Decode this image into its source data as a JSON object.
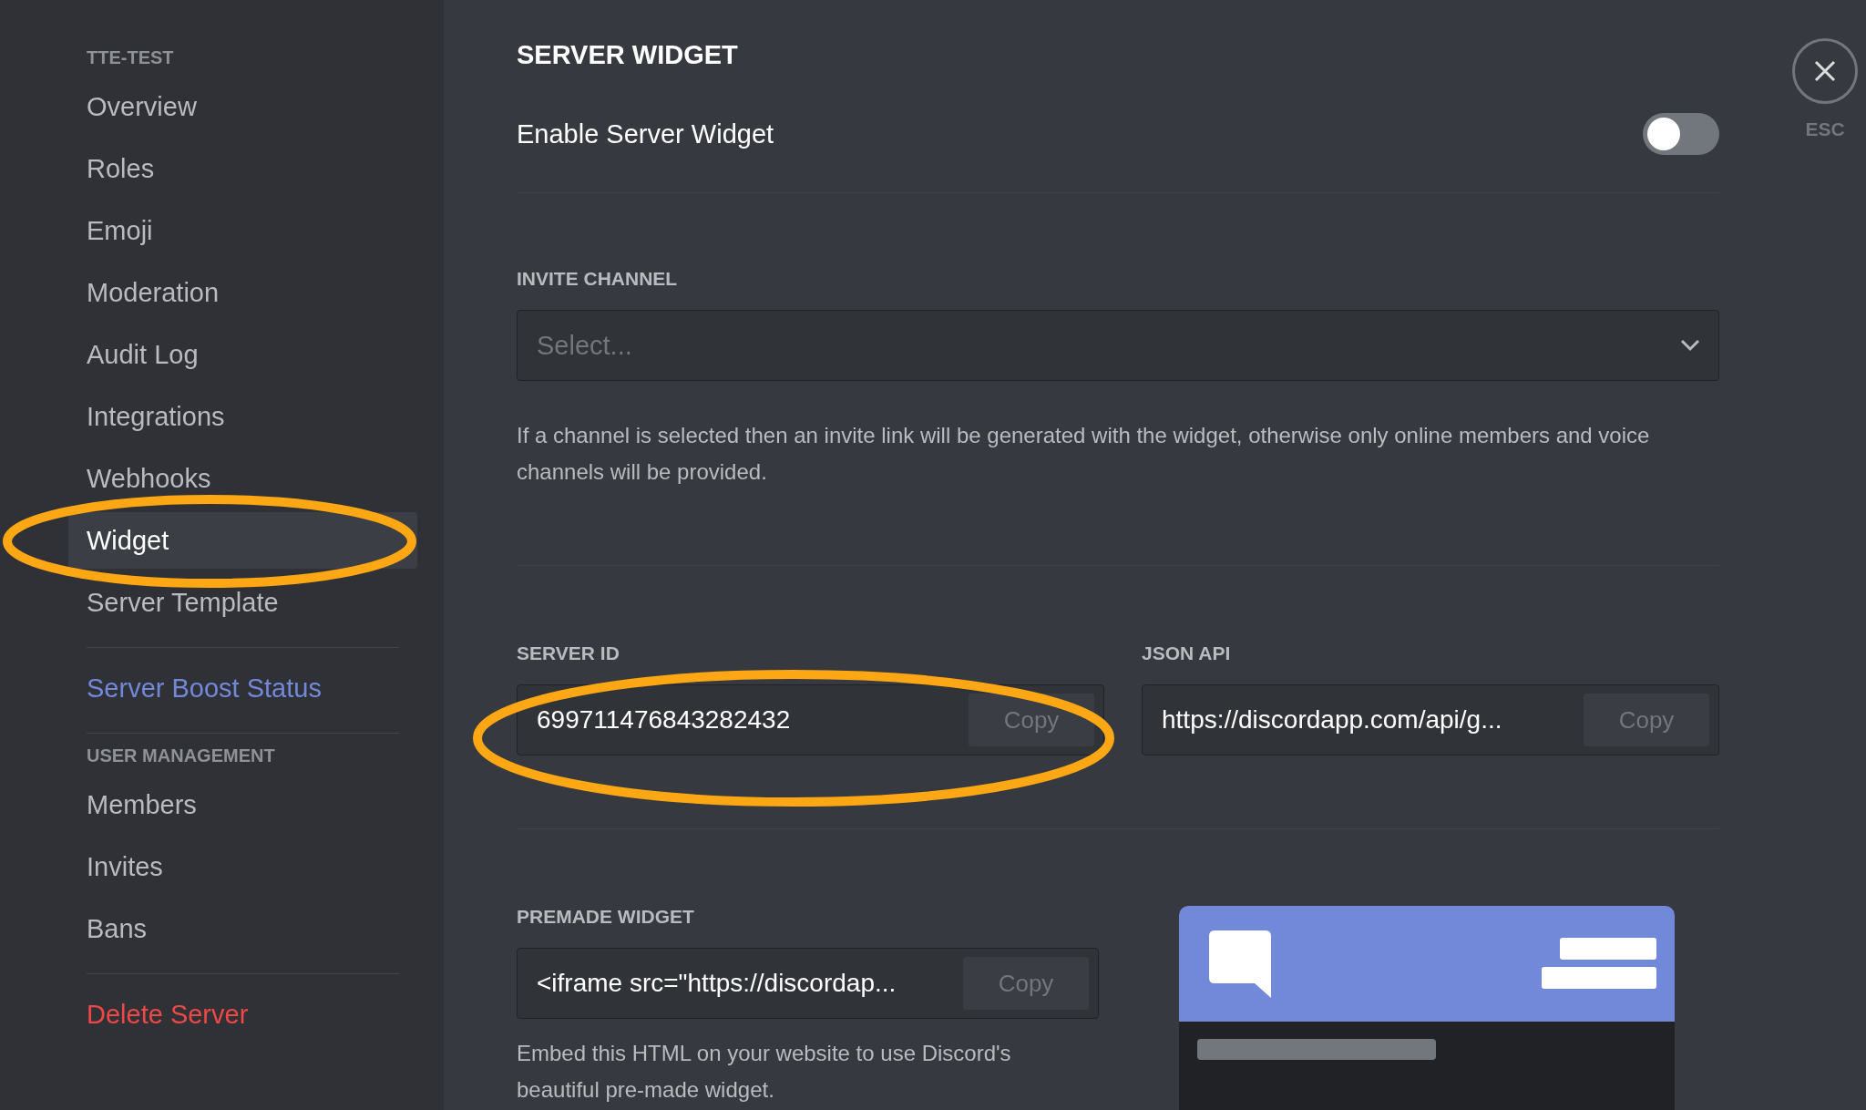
{
  "sidebar": {
    "groups": [
      {
        "header": "TTE-TEST",
        "items": [
          {
            "label": "Overview",
            "selected": false,
            "kind": "normal"
          },
          {
            "label": "Roles",
            "selected": false,
            "kind": "normal"
          },
          {
            "label": "Emoji",
            "selected": false,
            "kind": "normal"
          },
          {
            "label": "Moderation",
            "selected": false,
            "kind": "normal"
          },
          {
            "label": "Audit Log",
            "selected": false,
            "kind": "normal"
          },
          {
            "label": "Integrations",
            "selected": false,
            "kind": "normal"
          },
          {
            "label": "Webhooks",
            "selected": false,
            "kind": "normal"
          },
          {
            "label": "Widget",
            "selected": true,
            "kind": "normal"
          },
          {
            "label": "Server Template",
            "selected": false,
            "kind": "normal"
          }
        ]
      },
      {
        "items": [
          {
            "label": "Server Boost Status",
            "selected": false,
            "kind": "boost"
          }
        ]
      },
      {
        "header": "USER MANAGEMENT",
        "items": [
          {
            "label": "Members",
            "selected": false,
            "kind": "normal"
          },
          {
            "label": "Invites",
            "selected": false,
            "kind": "normal"
          },
          {
            "label": "Bans",
            "selected": false,
            "kind": "normal"
          }
        ]
      },
      {
        "items": [
          {
            "label": "Delete Server",
            "selected": false,
            "kind": "danger"
          }
        ]
      }
    ]
  },
  "main": {
    "title": "SERVER WIDGET",
    "enable_widget": {
      "label": "Enable Server Widget",
      "on": false
    },
    "invite_channel": {
      "label": "INVITE CHANNEL",
      "placeholder": "Select...",
      "help": "If a channel is selected then an invite link will be generated with the widget, otherwise only online members and voice channels will be provided."
    },
    "server_id": {
      "label": "SERVER ID",
      "value": "699711476843282432",
      "button": "Copy"
    },
    "json_api": {
      "label": "JSON API",
      "value": "https://discordapp.com/api/g...",
      "button": "Copy"
    },
    "premade_widget": {
      "label": "PREMADE WIDGET",
      "value": "<iframe src=\"https://discordap...",
      "button": "Copy",
      "help": "Embed this HTML on your website to use Discord's beautiful pre-made widget."
    }
  },
  "close": {
    "label": "ESC"
  }
}
